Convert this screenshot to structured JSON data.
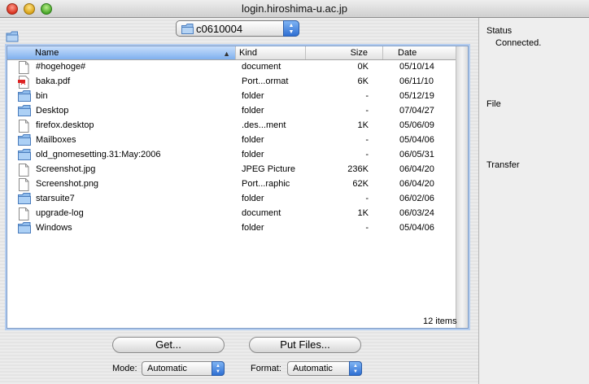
{
  "window": {
    "title": "login.hiroshima-u.ac.jp"
  },
  "path_popup": {
    "value": "c0610004"
  },
  "list": {
    "columns": {
      "name": "Name",
      "kind": "Kind",
      "size": "Size",
      "date": "Date"
    },
    "rows": [
      {
        "name": "#hogehoge#",
        "kind": "document",
        "size": "0K",
        "date": "05/10/14",
        "icon": "document-icon"
      },
      {
        "name": "baka.pdf",
        "kind": "Port...ormat",
        "size": "6K",
        "date": "06/11/10",
        "icon": "pdf-icon"
      },
      {
        "name": "bin",
        "kind": "folder",
        "size": "-",
        "date": "05/12/19",
        "icon": "folder-icon"
      },
      {
        "name": "Desktop",
        "kind": "folder",
        "size": "-",
        "date": "07/04/27",
        "icon": "folder-icon"
      },
      {
        "name": "firefox.desktop",
        "kind": ".des...ment",
        "size": "1K",
        "date": "05/06/09",
        "icon": "document-icon"
      },
      {
        "name": "Mailboxes",
        "kind": "folder",
        "size": "-",
        "date": "05/04/06",
        "icon": "folder-icon"
      },
      {
        "name": "old_gnomesetting.31:May:2006",
        "kind": "folder",
        "size": "-",
        "date": "06/05/31",
        "icon": "folder-icon"
      },
      {
        "name": "Screenshot.jpg",
        "kind": "JPEG Picture",
        "size": "236K",
        "date": "06/04/20",
        "icon": "document-icon"
      },
      {
        "name": "Screenshot.png",
        "kind": "Port...raphic",
        "size": "62K",
        "date": "06/04/20",
        "icon": "document-icon"
      },
      {
        "name": "starsuite7",
        "kind": "folder",
        "size": "-",
        "date": "06/02/06",
        "icon": "folder-icon"
      },
      {
        "name": "upgrade-log",
        "kind": "document",
        "size": "1K",
        "date": "06/03/24",
        "icon": "document-icon"
      },
      {
        "name": "Windows",
        "kind": "folder",
        "size": "-",
        "date": "05/04/06",
        "icon": "folder-icon"
      }
    ],
    "items_count": "12 items"
  },
  "buttons": {
    "get": "Get...",
    "put": "Put Files..."
  },
  "mode": {
    "label": "Mode:",
    "value": "Automatic"
  },
  "format": {
    "label": "Format:",
    "value": "Automatic"
  },
  "drawer": {
    "status_label": "Status",
    "status_value": "Connected.",
    "file_label": "File",
    "transfer_label": "Transfer"
  },
  "colors": {
    "header_selected": "#7fb0ee",
    "accent": "#2f6fd2"
  }
}
